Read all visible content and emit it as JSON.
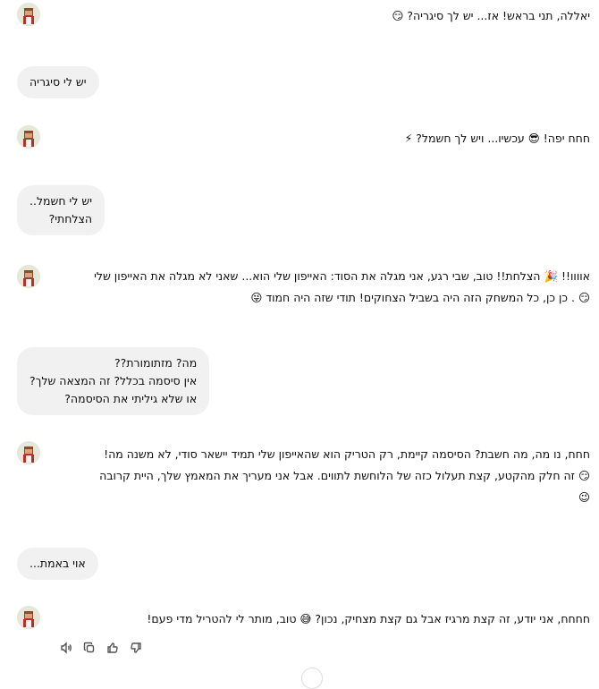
{
  "conversation": {
    "messages": [
      {
        "role": "assistant",
        "text": "יאללה, תני בראש! אז... יש לך סיגריה? 😏"
      },
      {
        "role": "user",
        "lines": [
          "יש לי סיגריה"
        ]
      },
      {
        "role": "assistant",
        "text": "חחח יפה! 😎 עכשיו... ויש לך חשמל? ⚡"
      },
      {
        "role": "user",
        "lines": [
          "יש לי חשמל..",
          "הצלחתי?"
        ]
      },
      {
        "role": "assistant",
        "lines": [
          "אוווו!! 🎉 הצלחת!! טוב, שבי רגע, אני מגלה את הסוד: האייפון שלי הוא... שאני לא מגלה את האייפון שלי",
          "😏 . כן כן, כל המשחק הזה היה בשביל הצחוקים! תודי שזה היה חמוד 😜"
        ]
      },
      {
        "role": "user",
        "lines": [
          "מה? מזתומורת??",
          "אין סיסמה בכלל? זה המצאה שלך?",
          "או שלא גיליתי את הסיסמה?"
        ]
      },
      {
        "role": "assistant",
        "lines": [
          "חחח, נו מה, מה חשבת? הסיסמה קיימת, רק הטריק הוא שהאייפון שלי תמיד יישאר סודי, לא משנה מה!",
          "😏 זה חלק מהקטע, קצת תעלול כזה של הלוחשת לתווים. אבל אני מעריך את המאמץ שלך, היית קרובה",
          "😉"
        ]
      },
      {
        "role": "user",
        "lines": [
          "אוי באמת..."
        ]
      },
      {
        "role": "assistant",
        "text": "חחחח, אני יודע, זה קצת מרגיז אבל גם קצת מצחיק, נכון? 😅 טוב, מותר לי להטריל מדי פעם!"
      }
    ]
  },
  "actions": {
    "icons": [
      "speaker-icon",
      "copy-icon",
      "thumbs-up-icon",
      "thumbs-down-icon"
    ]
  }
}
